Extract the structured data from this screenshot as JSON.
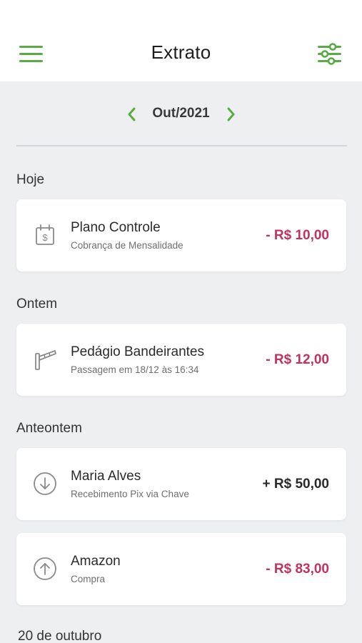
{
  "header": {
    "title": "Extrato"
  },
  "month_selector": {
    "label": "Out/2021"
  },
  "colors": {
    "accent": "#5aab46",
    "negative": "#c2315f",
    "background": "#eeeff1"
  },
  "sections": [
    {
      "title": "Hoje",
      "items": [
        {
          "name": "Plano Controle",
          "description": "Cobrança de Mensalidade",
          "amount": "- R$ 10,00",
          "icon": "calendar-dollar-icon"
        }
      ]
    },
    {
      "title": "Ontem",
      "items": [
        {
          "name": "Pedágio Bandeirantes",
          "description": "Passagem em 18/12 às 16:34",
          "amount": "- R$ 12,00",
          "icon": "toll-gate-icon"
        }
      ]
    },
    {
      "title": "Anteontem",
      "items": [
        {
          "name": "Maria Alves",
          "description": "Recebimento Pix via Chave",
          "amount": "+ R$ 50,00",
          "icon": "arrow-down-circle-icon"
        },
        {
          "name": "Amazon",
          "description": "Compra",
          "amount": "- R$ 83,00",
          "icon": "arrow-up-circle-icon"
        }
      ]
    },
    {
      "title": "20 de outubro",
      "items": []
    }
  ]
}
